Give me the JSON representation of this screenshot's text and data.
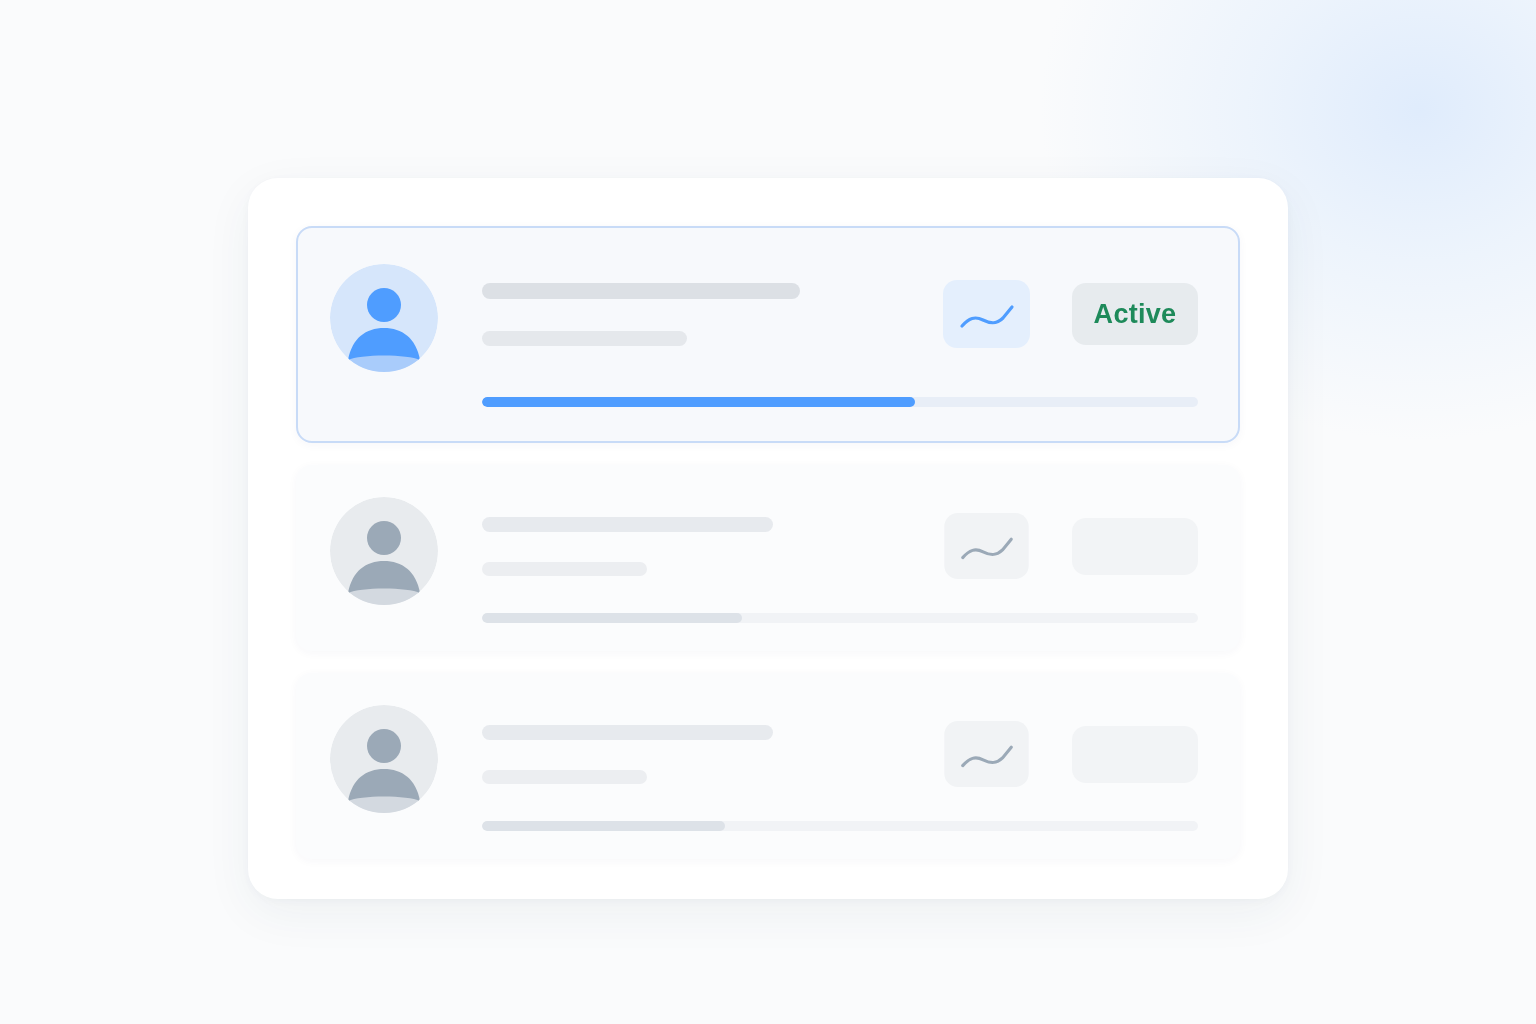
{
  "rows": [
    {
      "selected": true,
      "level": 0.605,
      "status": "Active"
    },
    {
      "selected": false,
      "level": 0.363
    },
    {
      "selected": false,
      "level": 0.34
    }
  ]
}
